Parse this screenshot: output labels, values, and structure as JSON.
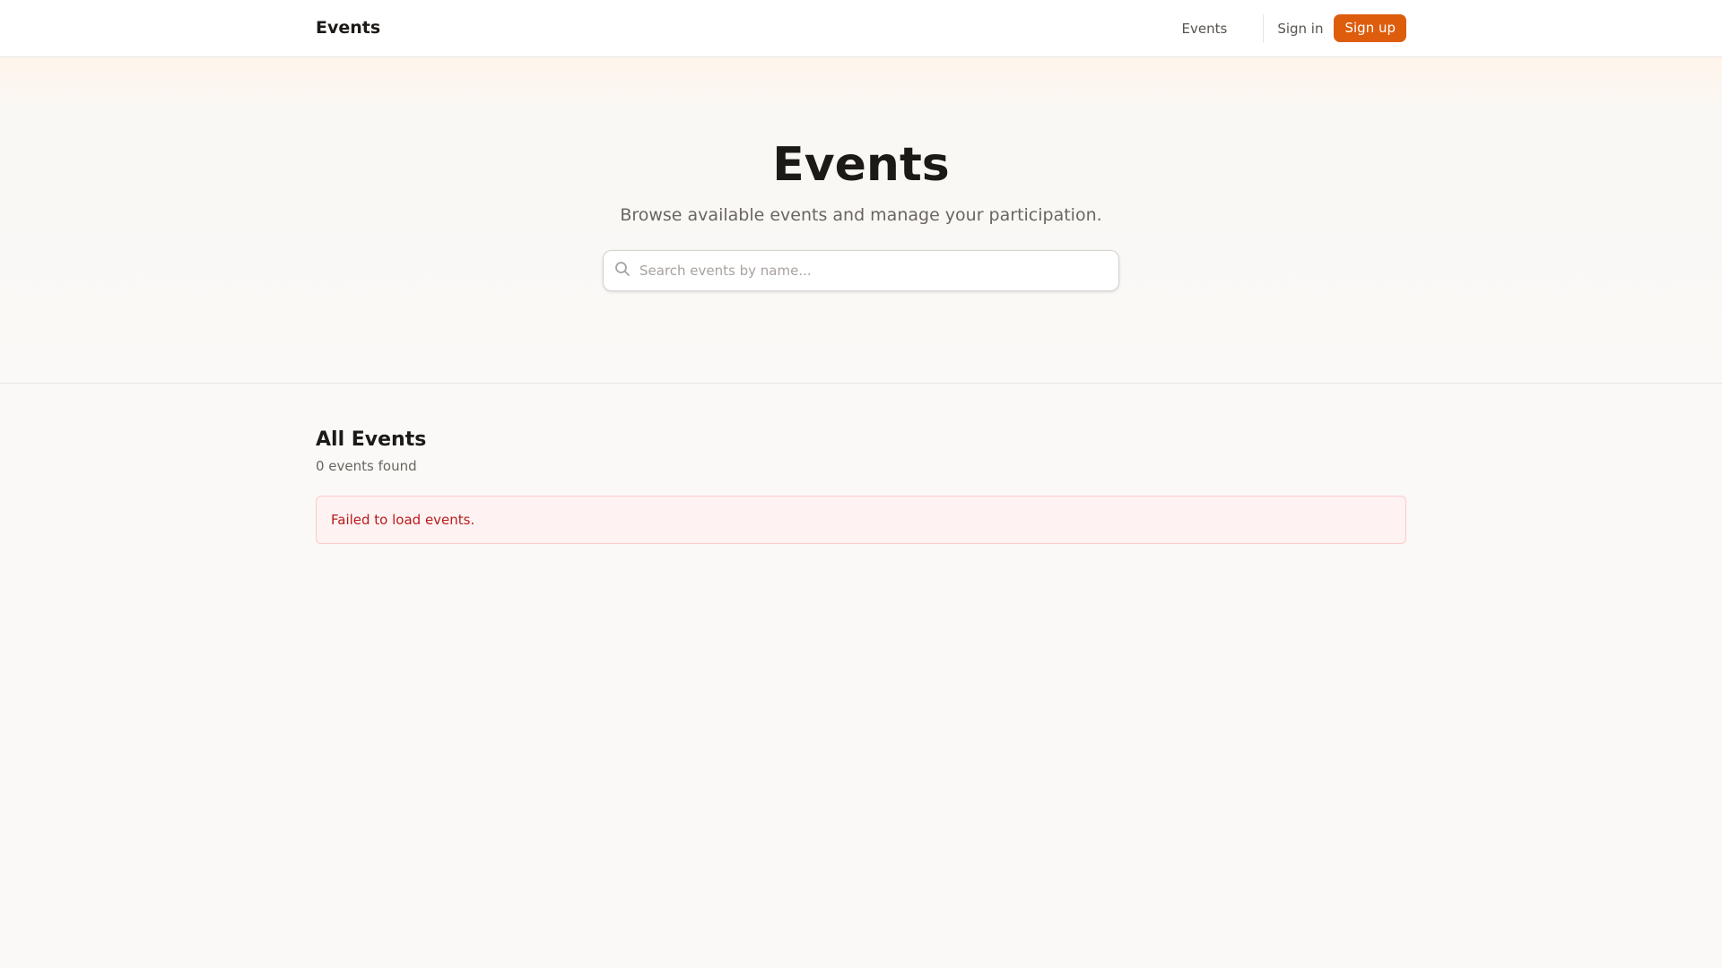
{
  "header": {
    "brand": "Events",
    "nav_events": "Events",
    "sign_in": "Sign in",
    "sign_up": "Sign up"
  },
  "hero": {
    "title": "Events",
    "subtitle": "Browse available events and manage your participation.",
    "search_placeholder": "Search events by name..."
  },
  "main": {
    "heading": "All Events",
    "count": "0 events found",
    "error": "Failed to load events."
  },
  "colors": {
    "accent": "#dd5d0c",
    "error": "#b91c1c"
  }
}
